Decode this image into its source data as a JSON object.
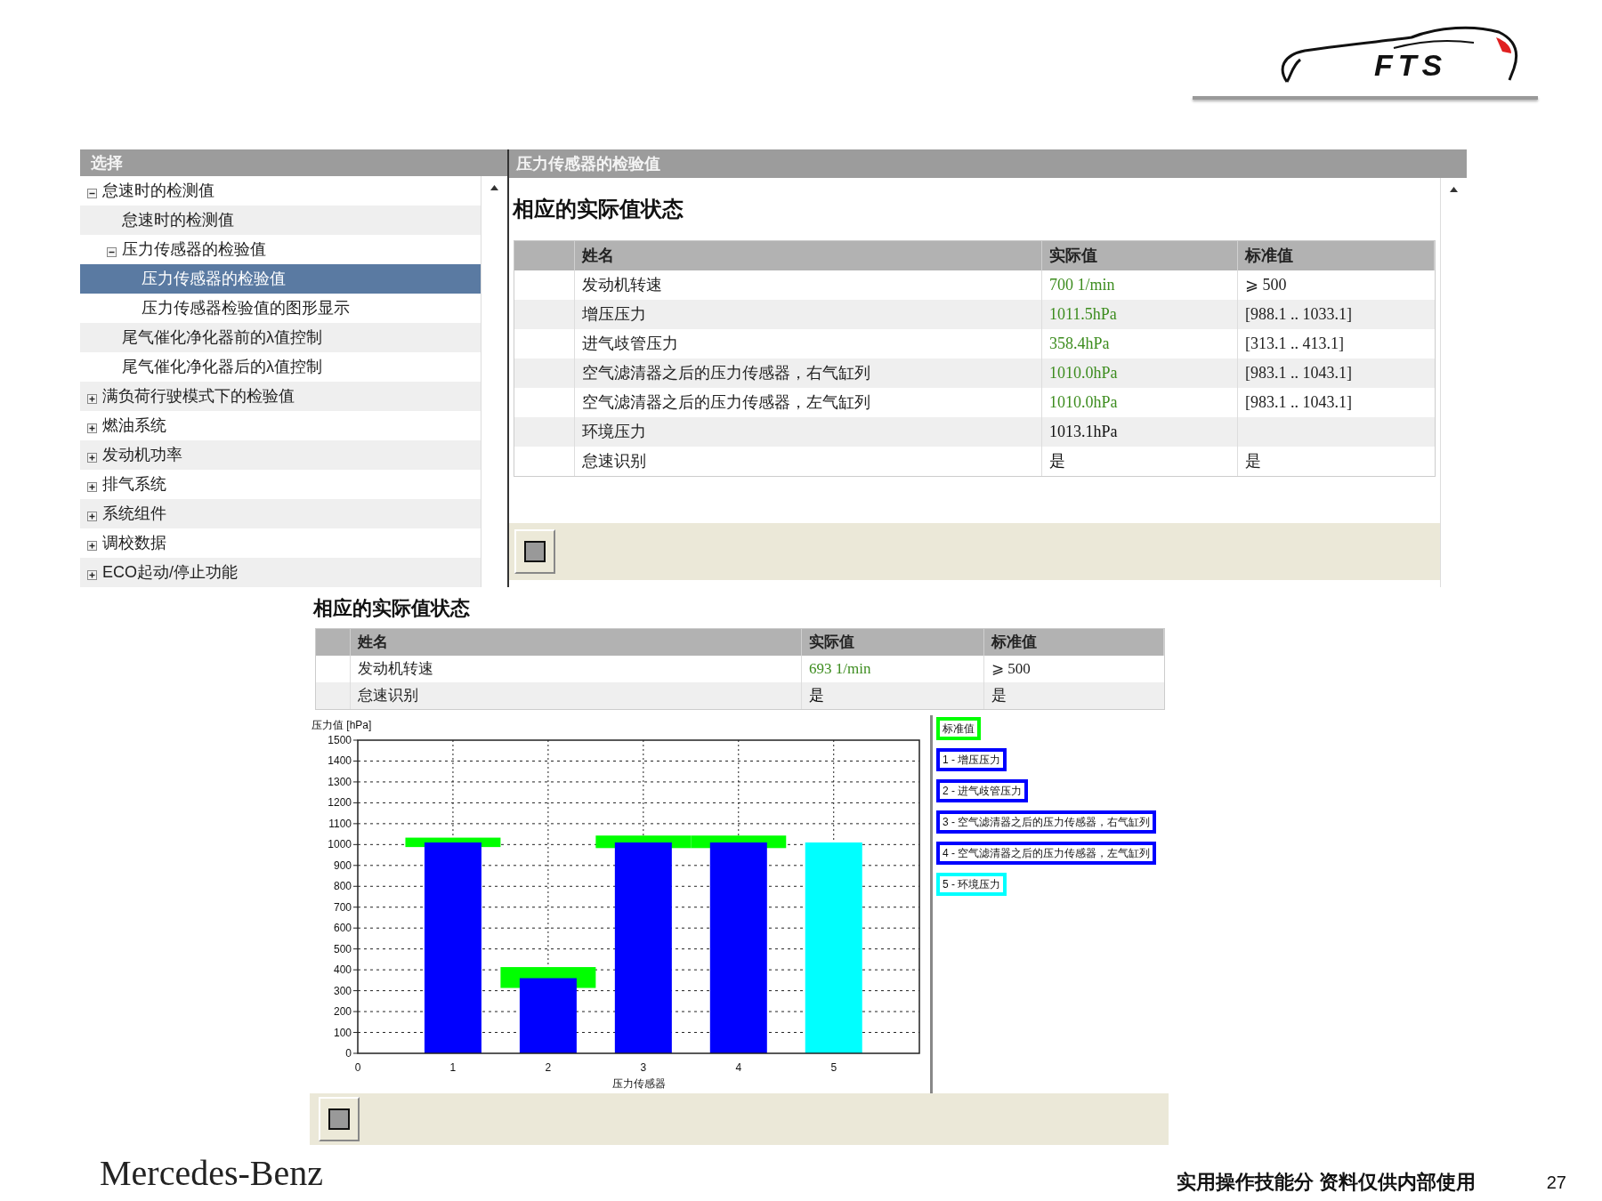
{
  "logo": {
    "text": "FTS"
  },
  "tree": {
    "title": "选择",
    "items": [
      {
        "label": "怠速时的检测值",
        "expanded": true,
        "selected": false,
        "children": [
          {
            "label": "怠速时的检测值",
            "selected": false
          },
          {
            "label": "压力传感器的检验值",
            "expanded": true,
            "selected": false,
            "children": [
              {
                "label": "压力传感器的检验值",
                "selected": true
              },
              {
                "label": "压力传感器检验值的图形显示",
                "selected": false
              }
            ]
          },
          {
            "label": "尾气催化净化器前的λ值控制",
            "selected": false
          },
          {
            "label": "尾气催化净化器后的λ值控制",
            "selected": false
          }
        ]
      },
      {
        "label": "满负荷行驶模式下的检验值",
        "expanded": false,
        "selected": false
      },
      {
        "label": "燃油系统",
        "expanded": false,
        "selected": false
      },
      {
        "label": "发动机功率",
        "expanded": false,
        "selected": false
      },
      {
        "label": "排气系统",
        "expanded": false,
        "selected": false
      },
      {
        "label": "系统组件",
        "expanded": false,
        "selected": false
      },
      {
        "label": "调校数据",
        "expanded": false,
        "selected": false
      },
      {
        "label": "ECO起动/停止功能",
        "expanded": false,
        "selected": false
      }
    ]
  },
  "detail": {
    "title": "压力传感器的检验值",
    "heading": "相应的实际值状态",
    "columns": [
      "姓名",
      "实际值",
      "标准值"
    ],
    "rows": [
      {
        "name": "发动机转速",
        "actual": "700 1/min",
        "standard": "⩾ 500",
        "color": "#3c8c1e"
      },
      {
        "name": "增压压力",
        "actual": "1011.5hPa",
        "standard": "[988.1 .. 1033.1]",
        "color": "#3c8c1e"
      },
      {
        "name": "进气歧管压力",
        "actual": "358.4hPa",
        "standard": "[313.1 .. 413.1]",
        "color": "#3c8c1e"
      },
      {
        "name": "空气滤清器之后的压力传感器，右气缸列",
        "actual": "1010.0hPa",
        "standard": "[983.1 .. 1043.1]",
        "color": "#3c8c1e"
      },
      {
        "name": "空气滤清器之后的压力传感器，左气缸列",
        "actual": "1010.0hPa",
        "standard": "[983.1 .. 1043.1]",
        "color": "#3c8c1e"
      },
      {
        "name": "环境压力",
        "actual": "1013.1hPa",
        "color": "#111111"
      },
      {
        "name": "怠速识别",
        "actual": "是",
        "standard": "是",
        "color": "#111111"
      }
    ]
  },
  "graph_view": {
    "heading": "相应的实际值状态",
    "columns": [
      "姓名",
      "实际值",
      "标准值"
    ],
    "rows": [
      {
        "name": "发动机转速",
        "actual": "693 1/min",
        "standard": "⩾ 500",
        "color": "#3c8c1e"
      },
      {
        "name": "怠速识别",
        "actual": "是",
        "standard": "是",
        "color": "#111111"
      }
    ],
    "chart_data": {
      "type": "bar",
      "ylabel": "压力值 [hPa]",
      "xlabel": "压力传感器",
      "x": [
        1,
        2,
        3,
        4,
        5
      ],
      "xlim": [
        0,
        5.9
      ],
      "ylim": [
        0,
        1500
      ],
      "xticks": [
        0,
        1,
        2,
        3,
        4,
        5
      ],
      "yticks": [
        0,
        100,
        200,
        300,
        400,
        500,
        600,
        700,
        800,
        900,
        1000,
        1100,
        1200,
        1300,
        1400,
        1500
      ],
      "series": [
        {
          "color": "#0000ff",
          "values": [
            1010,
            360,
            1010,
            1010,
            null
          ]
        },
        {
          "color": "#00ffff",
          "values": [
            null,
            null,
            null,
            null,
            1010
          ]
        }
      ],
      "grid": true,
      "bands": [
        {
          "axis": "y",
          "from": 988.1,
          "to": 1033.1,
          "color": "#00ff00"
        },
        {
          "axis": "y",
          "from": 313.1,
          "to": 413.1,
          "color": "#00ff00"
        },
        {
          "axis": "y",
          "from": 983.1,
          "to": 1043.1,
          "color": "#00ff00"
        },
        {
          "axis": "y",
          "from": 983.1,
          "to": 1043.1,
          "color": "#00ff00"
        }
      ]
    },
    "legend": [
      {
        "label": "标准值",
        "color": "#00ff00"
      },
      {
        "label": "1 - 增压压力",
        "color": "#0000ff"
      },
      {
        "label": "2 - 进气歧管压力",
        "color": "#0000ff"
      },
      {
        "label": "3 - 空气滤清器之后的压力传感器，右气缸列",
        "color": "#0000ff"
      },
      {
        "label": "4 - 空气滤清器之后的压力传感器，左气缸列",
        "color": "#0000ff"
      },
      {
        "label": "5 - 环境压力",
        "color": "#00ffff"
      }
    ]
  },
  "footer": {
    "brand": "Mercedes-Benz",
    "note": "实用操作技能分 资料仅供内部使用",
    "page": "27"
  }
}
